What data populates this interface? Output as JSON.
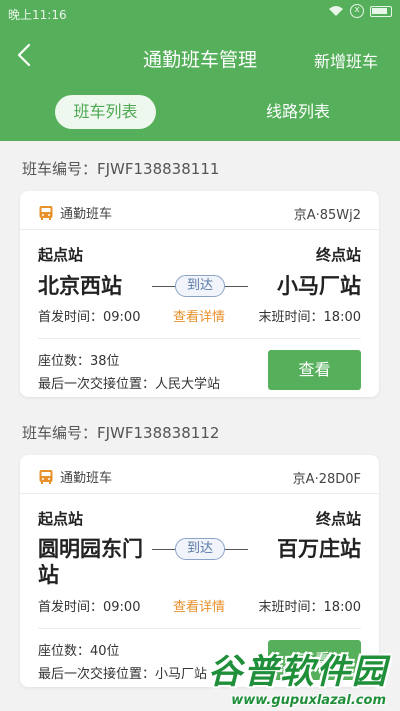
{
  "status_bar": {
    "time": "晚上11:16"
  },
  "header": {
    "title": "通勤班车管理",
    "add_label": "新增班车",
    "tabs": [
      {
        "label": "班车列表",
        "active": true
      },
      {
        "label": "线路列表",
        "active": false
      }
    ]
  },
  "buses": [
    {
      "number_label": "班车编号：FJWF138838111",
      "type": "通勤班车",
      "plate": "京A·85Wj2",
      "start_label": "起点站",
      "end_label": "终点站",
      "start_station": "北京西站",
      "end_station": "小马厂站",
      "arrive": "到达",
      "first_time": "首发时间：09:00",
      "details": "查看详情",
      "last_time": "末班时间：18:00",
      "seats": "座位数：38位",
      "last_position": "最后一次交接位置：人民大学站",
      "view_label": "查看"
    },
    {
      "number_label": "班车编号：FJWF138838112",
      "type": "通勤班车",
      "plate": "京A·28D0F",
      "start_label": "起点站",
      "end_label": "终点站",
      "start_station": "圆明园东门站",
      "end_station": "百万庄站",
      "arrive": "到达",
      "first_time": "首发时间：09:00",
      "details": "查看详情",
      "last_time": "末班时间：18:00",
      "seats": "座位数：40位",
      "last_position": "最后一次交接位置：小马厂站",
      "view_label": "查看"
    }
  ],
  "watermark": {
    "title": "谷普软件园",
    "url": "www.gupuxlazal.com"
  },
  "colors": {
    "primary": "#56b05b",
    "accent": "#e8902a",
    "background": "#f2f2f2"
  }
}
